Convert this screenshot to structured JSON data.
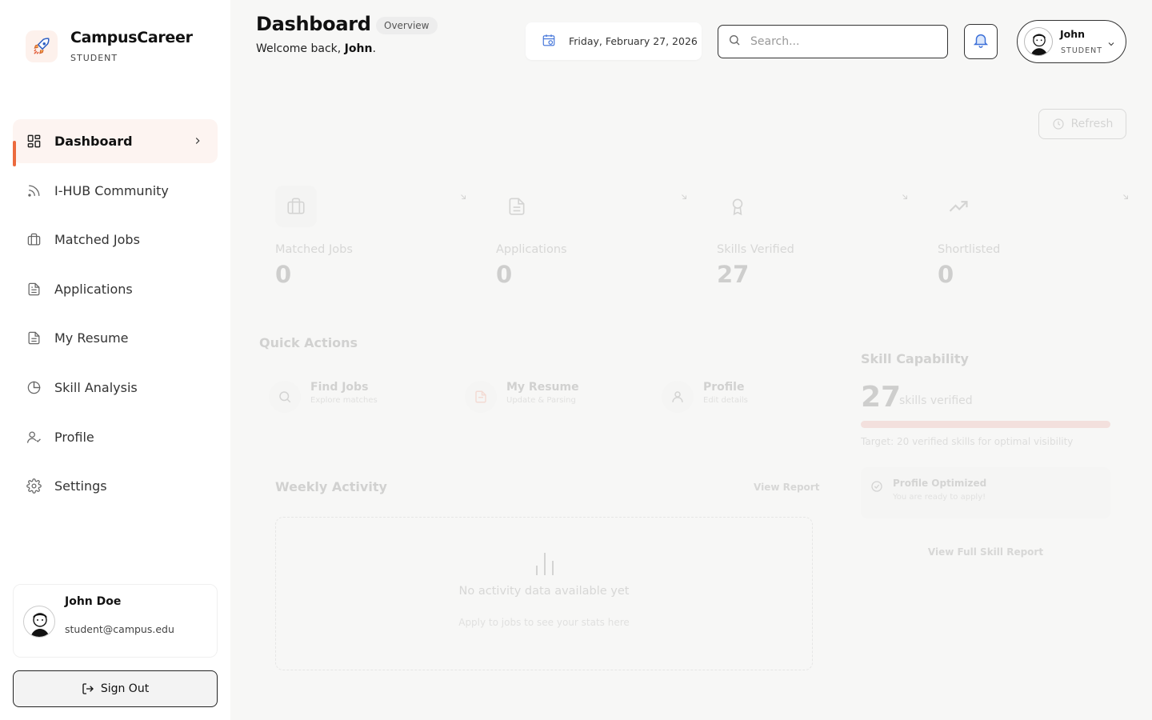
{
  "brand": {
    "name": "CampusCareer",
    "role": "STUDENT"
  },
  "nav": {
    "items": [
      {
        "label": "Dashboard",
        "icon": "grid-icon",
        "active": true
      },
      {
        "label": "I-HUB Community",
        "icon": "rss-icon"
      },
      {
        "label": "Matched Jobs",
        "icon": "briefcase-icon"
      },
      {
        "label": "Applications",
        "icon": "file-icon"
      },
      {
        "label": "My Resume",
        "icon": "document-icon"
      },
      {
        "label": "Skill Analysis",
        "icon": "pie-chart-icon"
      },
      {
        "label": "Profile",
        "icon": "user-check-icon"
      },
      {
        "label": "Settings",
        "icon": "gear-icon"
      }
    ]
  },
  "user": {
    "name": "John Doe",
    "email": "student@campus.edu"
  },
  "signout": {
    "label": "Sign Out"
  },
  "header": {
    "title": "Dashboard",
    "badge": "Overview",
    "welcome_prefix": "Welcome back, ",
    "welcome_name": "John",
    "welcome_suffix": ".",
    "date": "Friday, February 27, 2026",
    "search_placeholder": "Search...",
    "profile_name": "John",
    "profile_role": "STUDENT"
  },
  "refresh": {
    "label": "Refresh"
  },
  "stats": [
    {
      "label": "Matched Jobs",
      "value": "0",
      "icon": "briefcase-icon"
    },
    {
      "label": "Applications",
      "value": "0",
      "icon": "file-icon"
    },
    {
      "label": "Skills Verified",
      "value": "27",
      "icon": "award-icon"
    },
    {
      "label": "Shortlisted",
      "value": "0",
      "icon": "trending-up-icon"
    }
  ],
  "quick_actions": {
    "title": "Quick Actions",
    "items": [
      {
        "label": "Find Jobs",
        "sub": "Explore matches",
        "icon": "search-icon"
      },
      {
        "label": "My Resume",
        "sub": "Update & Parsing",
        "icon": "file-icon"
      },
      {
        "label": "Profile",
        "sub": "Edit details",
        "icon": "user-icon"
      }
    ]
  },
  "weekly": {
    "title": "Weekly Activity",
    "link": "View Report",
    "empty": "No activity data available yet",
    "hint": "Apply to jobs to see your stats here"
  },
  "skill": {
    "title": "Skill Capability",
    "count": "27",
    "unit": "skills verified",
    "progress": 1.0,
    "target": "Target: 20 verified skills for optimal visibility",
    "opt_title": "Profile Optimized",
    "opt_sub": "You are ready to apply!",
    "link": "View Full Skill Report"
  },
  "colors": {
    "accent": "#ec6a3e",
    "active_bg": "#fdf4f1",
    "bell": "#3b6fd8"
  }
}
